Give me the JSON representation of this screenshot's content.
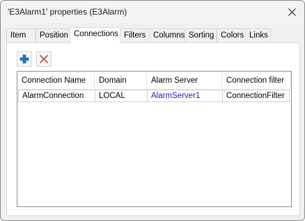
{
  "window": {
    "title": "'E3Alarm1' properties (E3Alarm)",
    "close_icon": "close-icon"
  },
  "tabs": [
    {
      "label": "Item",
      "active": false
    },
    {
      "label": "Position",
      "active": false
    },
    {
      "label": "Connections",
      "active": true
    },
    {
      "label": "Filters",
      "active": false
    },
    {
      "label": "Columns",
      "active": false
    },
    {
      "label": "Sorting",
      "active": false
    },
    {
      "label": "Colors",
      "active": false
    },
    {
      "label": "Links",
      "active": false
    }
  ],
  "toolbar": {
    "add_icon": "plus-icon",
    "remove_icon": "x-icon",
    "add_color": "#1e78c8",
    "remove_color": "#c0504d"
  },
  "table": {
    "columns": [
      "Connection Name",
      "Domain",
      "Alarm Server",
      "Connection filter"
    ],
    "rows": [
      [
        "AlarmConnection",
        "LOCAL",
        "AlarmServer1",
        "ConnectionFilter"
      ]
    ],
    "link_color": "#1a1acc"
  }
}
